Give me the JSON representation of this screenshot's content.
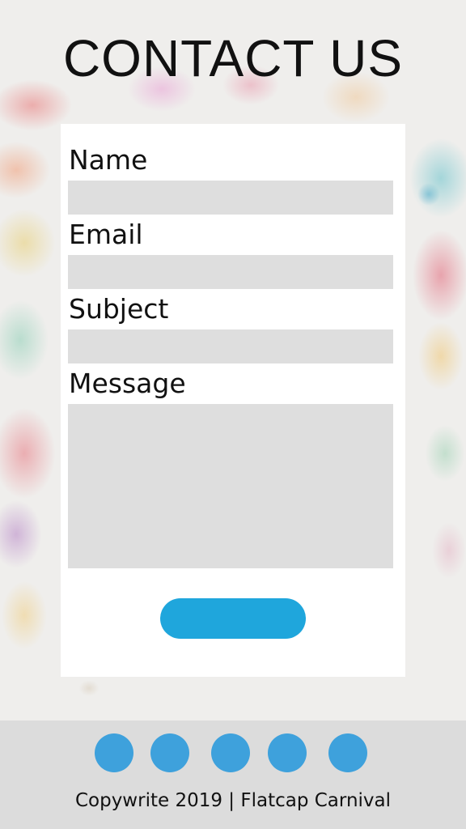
{
  "header": {
    "title": "CONTACT US"
  },
  "form": {
    "fields": [
      {
        "label": "Name",
        "value": "",
        "placeholder": ""
      },
      {
        "label": "Email",
        "value": "",
        "placeholder": ""
      },
      {
        "label": "Subject",
        "value": "",
        "placeholder": ""
      },
      {
        "label": "Message",
        "value": "",
        "placeholder": ""
      }
    ],
    "submit_label": ""
  },
  "footer": {
    "social_icons": [
      "social-icon-1",
      "social-icon-2",
      "social-icon-3",
      "social-icon-4",
      "social-icon-5"
    ],
    "copyright": "Copywrite 2019 | Flatcap Carnival"
  },
  "colors": {
    "accent": "#1fa6dc",
    "dots": "#3ea1dc",
    "field_bg": "#dedede",
    "footer_bg": "#dcdcdc"
  }
}
